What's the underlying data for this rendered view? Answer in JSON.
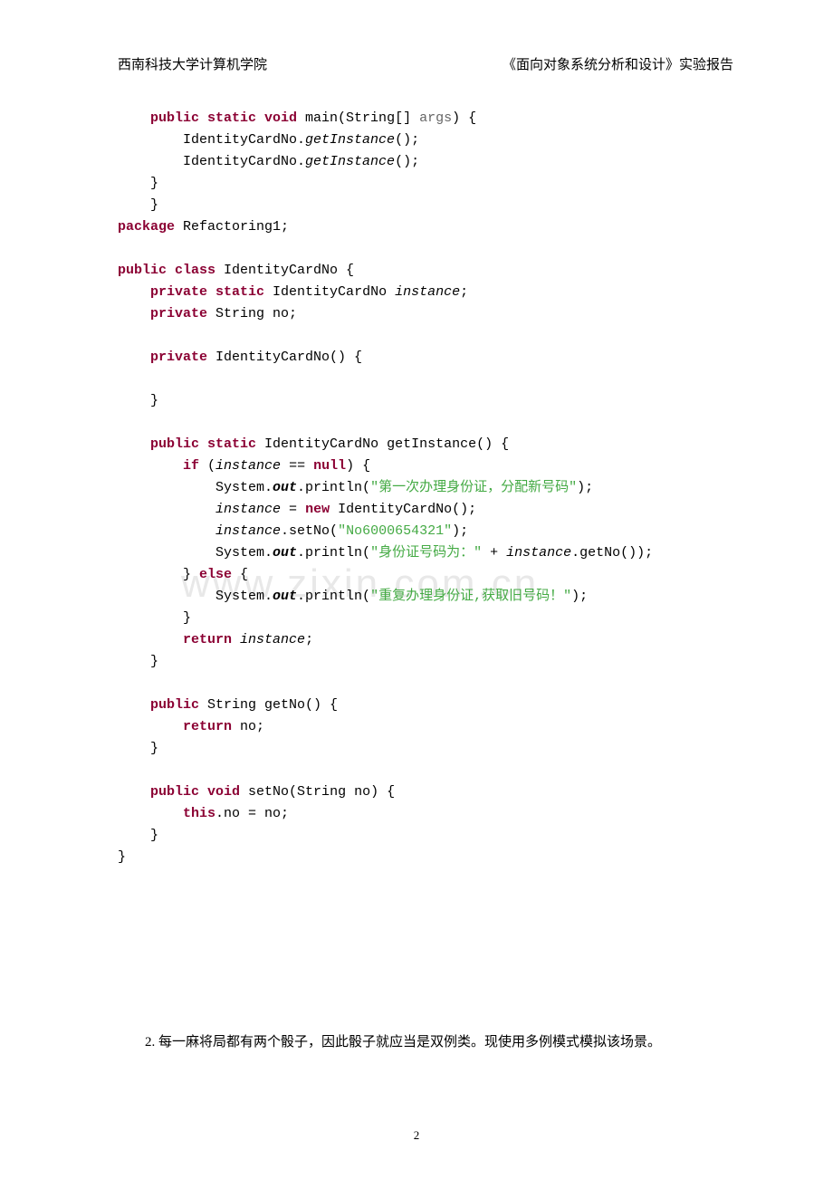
{
  "header": {
    "left": "西南科技大学计算机学院",
    "right": "《面向对象系统分析和设计》实验报告"
  },
  "watermark": "www.zixin.com.cn",
  "code": {
    "line1_indent": "    ",
    "line1_kw1": "public static void",
    "line1_method": " main(String[] ",
    "line1_args": "args",
    "line1_end": ") {",
    "line2": "        IdentityCardNo.",
    "line2_method": "getInstance",
    "line2_end": "();",
    "line3": "        IdentityCardNo.",
    "line3_method": "getInstance",
    "line3_end": "();",
    "line4": "    }",
    "line5": "    }",
    "line6_kw": "package",
    "line6_txt": " Refactoring1;",
    "line7": "",
    "line8_kw": "public class",
    "line8_txt": " IdentityCardNo {",
    "line9_indent": "    ",
    "line9_kw": "private static",
    "line9_type": " IdentityCardNo ",
    "line9_var": "instance",
    "line9_end": ";",
    "line10_indent": "    ",
    "line10_kw": "private",
    "line10_txt": " String no;",
    "line11": "",
    "line12_indent": "    ",
    "line12_kw": "private",
    "line12_txt": " IdentityCardNo() {",
    "line13": "",
    "line14": "    }",
    "line15": "",
    "line16_indent": "    ",
    "line16_kw": "public static",
    "line16_txt": " IdentityCardNo getInstance() {",
    "line17_indent": "        ",
    "line17_kw1": "if",
    "line17_txt1": " (",
    "line17_var": "instance",
    "line17_txt2": " == ",
    "line17_kw2": "null",
    "line17_txt3": ") {",
    "line18_indent": "            System.",
    "line18_out": "out",
    "line18_txt": ".println(",
    "line18_str": "\"第一次办理身份证，分配新号码\"",
    "line18_end": ");",
    "line19_indent": "            ",
    "line19_var": "instance",
    "line19_txt": " = ",
    "line19_kw": "new",
    "line19_end": " IdentityCardNo();",
    "line20_indent": "            ",
    "line20_var": "instance",
    "line20_txt": ".setNo(",
    "line20_str": "\"No6000654321\"",
    "line20_end": ");",
    "line21_indent": "            System.",
    "line21_out": "out",
    "line21_txt": ".println(",
    "line21_str": "\"身份证号码为：\"",
    "line21_plus": " + ",
    "line21_var": "instance",
    "line21_end": ".getNo());",
    "line22_indent": "        } ",
    "line22_kw": "else",
    "line22_end": " {",
    "line23_indent": "            System.",
    "line23_out": "out",
    "line23_txt": ".println(",
    "line23_str": "\"重复办理身份证,获取旧号码！\"",
    "line23_end": ");",
    "line24": "        }",
    "line25_indent": "        ",
    "line25_kw": "return",
    "line25_txt": " ",
    "line25_var": "instance",
    "line25_end": ";",
    "line26": "    }",
    "line27": "",
    "line28_indent": "    ",
    "line28_kw": "public",
    "line28_txt": " String getNo() {",
    "line29_indent": "        ",
    "line29_kw": "return",
    "line29_txt": " no;",
    "line30": "    }",
    "line31": "",
    "line32_indent": "    ",
    "line32_kw": "public void",
    "line32_txt": " setNo(String no) {",
    "line33_indent": "        ",
    "line33_kw": "this",
    "line33_txt": ".no = no;",
    "line34": "    }",
    "line35": "}"
  },
  "question": "2. 每一麻将局都有两个骰子，因此骰子就应当是双例类。现使用多例模式模拟该场景。",
  "pageNumber": "2"
}
